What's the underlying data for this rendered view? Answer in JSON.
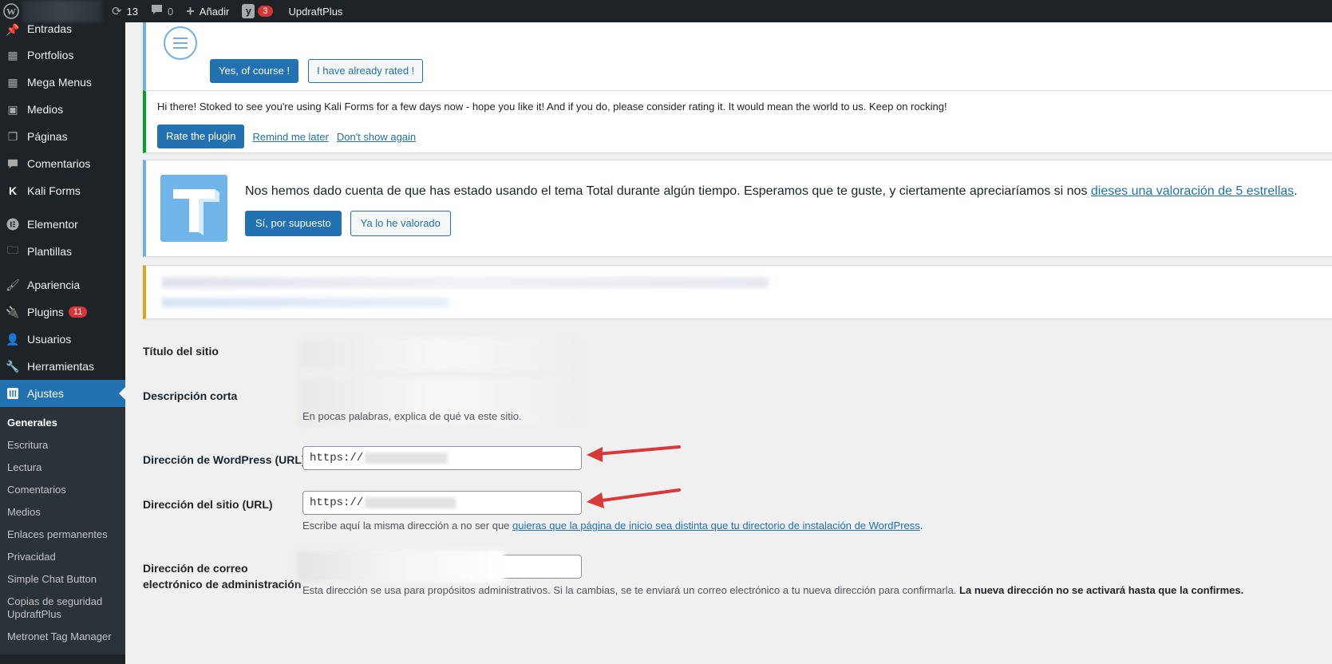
{
  "adminbar": {
    "updates_count": "13",
    "comments_count": "0",
    "add_new_label": "Añadir",
    "yoast_badge": "3",
    "updraft_label": "UpdraftPlus"
  },
  "sidebar": {
    "items": [
      {
        "label": "Entradas",
        "icon": "pin-icon"
      },
      {
        "label": "Portfolios",
        "icon": "grid-icon"
      },
      {
        "label": "Mega Menus",
        "icon": "grid-icon"
      },
      {
        "label": "Medios",
        "icon": "media-icon"
      },
      {
        "label": "Páginas",
        "icon": "pages-icon"
      },
      {
        "label": "Comentarios",
        "icon": "comment-icon"
      },
      {
        "label": "Kali Forms",
        "icon": "kali-icon"
      },
      {
        "label": "Elementor",
        "icon": "elementor-icon"
      },
      {
        "label": "Plantillas",
        "icon": "folder-icon"
      },
      {
        "label": "Apariencia",
        "icon": "brush-icon"
      },
      {
        "label": "Plugins",
        "icon": "plugin-icon",
        "badge": "11"
      },
      {
        "label": "Usuarios",
        "icon": "user-icon"
      },
      {
        "label": "Herramientas",
        "icon": "wrench-icon"
      },
      {
        "label": "Ajustes",
        "icon": "settings-icon"
      }
    ],
    "submenu": [
      "Generales",
      "Escritura",
      "Lectura",
      "Comentarios",
      "Medios",
      "Enlaces permanentes",
      "Privacidad",
      "Simple Chat Button",
      "Copias de seguridad UpdraftPlus",
      "Metronet Tag Manager"
    ]
  },
  "notice1": {
    "yes_label": "Yes, of course !",
    "rated_label": "I have already rated !"
  },
  "notice2": {
    "text": "Hi there! Stoked to see you're using Kali Forms for a few days now - hope you like it! And if you do, please consider rating it. It would mean the world to us. Keep on rocking!",
    "rate_label": "Rate the plugin",
    "remind_label": "Remind me later",
    "dont_show_label": "Don't show again"
  },
  "notice3": {
    "text": "Nos hemos dado cuenta de que has estado usando el tema Total durante algún tiempo. Esperamos que te guste, y ciertamente apreciaríamos si nos ",
    "link_text": "dieses una valoración de 5 estrellas",
    "yes_label": "Sí, por supuesto",
    "rated_label": "Ya lo he valorado"
  },
  "form": {
    "site_title_label": "Título del sitio",
    "tagline_label": "Descripción corta",
    "tagline_desc": "En pocas palabras, explica de qué va este sitio.",
    "wp_url_label": "Dirección de WordPress (URL)",
    "wp_url_value": "https://",
    "site_url_label": "Dirección del sitio (URL)",
    "site_url_value": "https://",
    "site_url_desc_prefix": "Escribe aquí la misma dirección a no ser que ",
    "site_url_desc_link": "quieras que la página de inicio sea distinta que tu directorio de instalación de WordPress",
    "site_url_desc_suffix": ".",
    "admin_email_label": "Dirección de correo electrónico de administración",
    "admin_email_desc": "Esta dirección se usa para propósitos administrativos. Si la cambias, se te enviará un correo electrónico a tu nueva dirección para confirmarla. ",
    "admin_email_desc_bold": "La nueva dirección no se activará hasta que la confirmes."
  },
  "colors": {
    "admin_dark": "#1d2327",
    "wp_blue": "#2271b1",
    "badge_red": "#d63638",
    "arrow_red": "#d93838"
  }
}
